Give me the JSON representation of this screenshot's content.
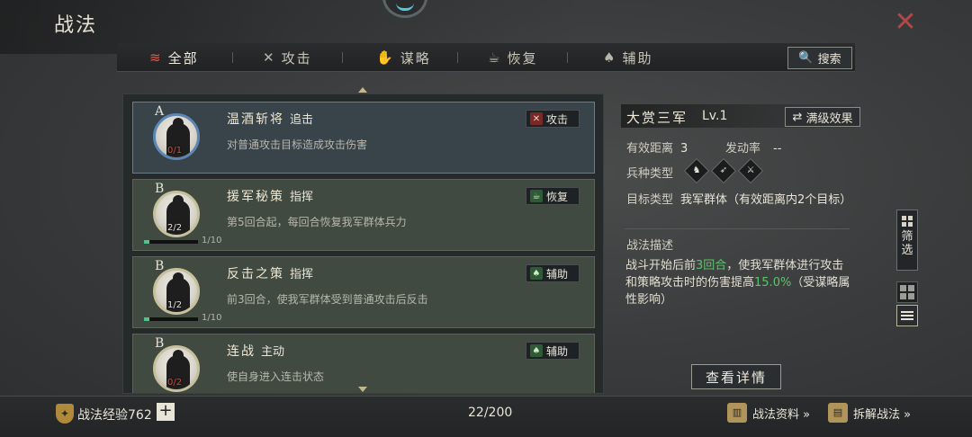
{
  "header": {
    "title": "战法",
    "close_icon": "close-x-icon",
    "accent": "#b04848"
  },
  "tabs": [
    {
      "label": "全部",
      "icon": "scroll-icon",
      "active": true
    },
    {
      "label": "攻击",
      "icon": "crossed-swords-icon",
      "active": false
    },
    {
      "label": "谋略",
      "icon": "hand-icon",
      "active": false
    },
    {
      "label": "恢复",
      "icon": "kettle-icon",
      "active": false
    },
    {
      "label": "辅助",
      "icon": "pouch-icon",
      "active": false
    }
  ],
  "search": {
    "label": "搜索",
    "icon": "search-icon"
  },
  "skills": [
    {
      "grade": "A",
      "name": "温酒斩将",
      "type_label": "追击",
      "desc": "对普通攻击目标造成攻击伤害",
      "badge": "攻击",
      "badge_icon": "crossed-swords-icon",
      "count": "0/1",
      "progress": "",
      "progress_ratio": 0,
      "selected": true
    },
    {
      "grade": "B",
      "name": "援军秘策",
      "type_label": "指挥",
      "desc": "第5回合起，每回合恢复我军群体兵力",
      "badge": "恢复",
      "badge_icon": "kettle-icon",
      "count": "2/2",
      "progress": "1/10",
      "progress_ratio": 0.1,
      "selected": false
    },
    {
      "grade": "B",
      "name": "反击之策",
      "type_label": "指挥",
      "desc": "前3回合，使我军群体受到普通攻击后反击",
      "badge": "辅助",
      "badge_icon": "pouch-icon",
      "count": "1/2",
      "progress": "1/10",
      "progress_ratio": 0.1,
      "selected": false
    },
    {
      "grade": "B",
      "name": "连战",
      "type_label": "主动",
      "desc": "使自身进入连击状态",
      "badge": "辅助",
      "badge_icon": "pouch-icon",
      "count": "0/2",
      "progress": "",
      "progress_ratio": 0,
      "selected": false
    }
  ],
  "detail": {
    "name": "大赏三军",
    "level": "Lv.1",
    "max_effect_label": "满级效果",
    "range_label": "有效距离",
    "range_value": "3",
    "rate_label": "发动率",
    "rate_value": "--",
    "troop_label": "兵种类型",
    "troop_icons": [
      "cavalry-icon",
      "archer-icon",
      "spear-icon"
    ],
    "target_label": "目标类型",
    "target_value": "我军群体（有效距离内2个目标）",
    "desc_title": "战法描述",
    "desc_1": "战斗开始后前",
    "desc_hl_1": "3回合",
    "desc_2": "，使我军群体进行攻击和策略攻击时的伤害提高",
    "desc_hl_2": "15.0%",
    "desc_3": "（受谋略属性影响）",
    "view_button": "查看详情",
    "highlight_color": "#5cc46a"
  },
  "side": {
    "filter_label": "筛选",
    "filter_icon": "grid-filter-icon",
    "grid_view_icon": "grid-view-icon",
    "list_view_icon": "list-view-icon"
  },
  "footer": {
    "exp_label": "战法经验762",
    "exp_icon": "exp-shield-icon",
    "plus": "+",
    "capacity": "22/200",
    "data_link": "战法资料 »",
    "data_icon": "book-icon",
    "disassemble_link": "拆解战法 »",
    "disassemble_icon": "bamboo-scroll-icon"
  }
}
